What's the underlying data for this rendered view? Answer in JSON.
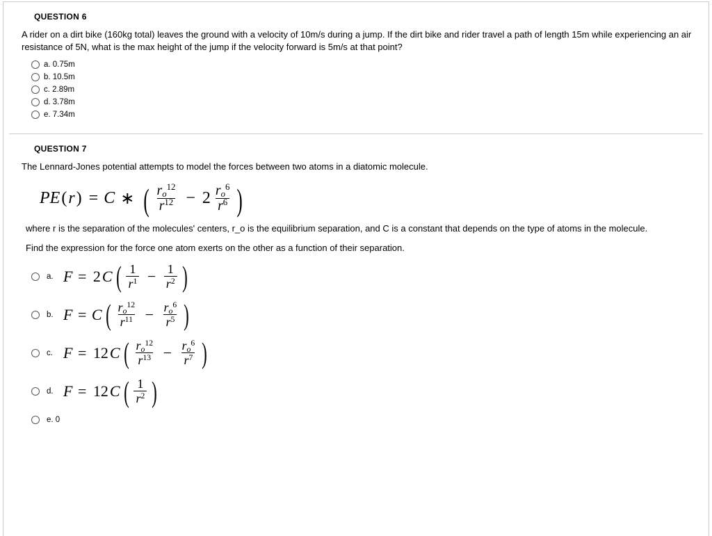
{
  "q6": {
    "header": "QUESTION 6",
    "prompt": "A rider on a dirt bike (160kg total) leaves the ground with a velocity of 10m/s during a jump. If the dirt bike and rider travel a path of length 15m while experiencing an air resistance of 5N, what is the max height of the jump if the velocity forward is 5m/s at that point?",
    "options": {
      "a": "a. 0.75m",
      "b": "b. 10.5m",
      "c": "c. 2.89m",
      "d": "d. 3.78m",
      "e": "e. 7.34m"
    }
  },
  "q7": {
    "header": "QUESTION 7",
    "intro": "The Lennard-Jones potential attempts to model the forces between two atoms in a diatomic molecule.",
    "explain1": "where r is the separation of the molecules' centers, r_o is the equilibrium separation, and C is a constant that depends on the type of atoms in the molecule.",
    "explain2": "Find the expression for the force one atom exerts on the other as a function of their separation.",
    "main_formula": {
      "lhs": "PE(r) = C ∗ (",
      "term1_num_base": "r",
      "term1_num_sub": "o",
      "term1_num_sup": "12",
      "term1_den_base": "r",
      "term1_den_sup": "12",
      "minus": " − 2",
      "term2_num_base": "r",
      "term2_num_sub": "o",
      "term2_num_sup": "6",
      "term2_den_base": "r",
      "term2_den_sup": "6",
      "rparen": ")"
    },
    "letters": {
      "a": "a.",
      "b": "b.",
      "c": "c.",
      "d": "d.",
      "e": "e. 0"
    },
    "opt_a": {
      "lhs": "F = 2C(",
      "t1_num": "1",
      "t1_den_base": "r",
      "t1_den_sup": "1",
      "minus": " − ",
      "t2_num": "1",
      "t2_den_base": "r",
      "t2_den_sup": "2",
      "rparen": ")"
    },
    "opt_b": {
      "lhs": "F = C(",
      "t1_num_base": "r",
      "t1_num_sub": "o",
      "t1_num_sup": "12",
      "t1_den_base": "r",
      "t1_den_sup": "11",
      "minus": " − ",
      "t2_num_base": "r",
      "t2_num_sub": "o",
      "t2_num_sup": "6",
      "t2_den_base": "r",
      "t2_den_sup": "5",
      "rparen": ")"
    },
    "opt_c": {
      "lhs": "F = 12C(",
      "t1_num_base": "r",
      "t1_num_sub": "o",
      "t1_num_sup": "12",
      "t1_den_base": "r",
      "t1_den_sup": "13",
      "minus": " − ",
      "t2_num_base": "r",
      "t2_num_sub": "o",
      "t2_num_sup": "6",
      "t2_den_base": "r",
      "t2_den_sup": "7",
      "rparen": ")"
    },
    "opt_d": {
      "lhs": "F = 12C(",
      "t1_num": "1",
      "t1_den_base": "r",
      "t1_den_sup": "2",
      "rparen": ")"
    }
  }
}
